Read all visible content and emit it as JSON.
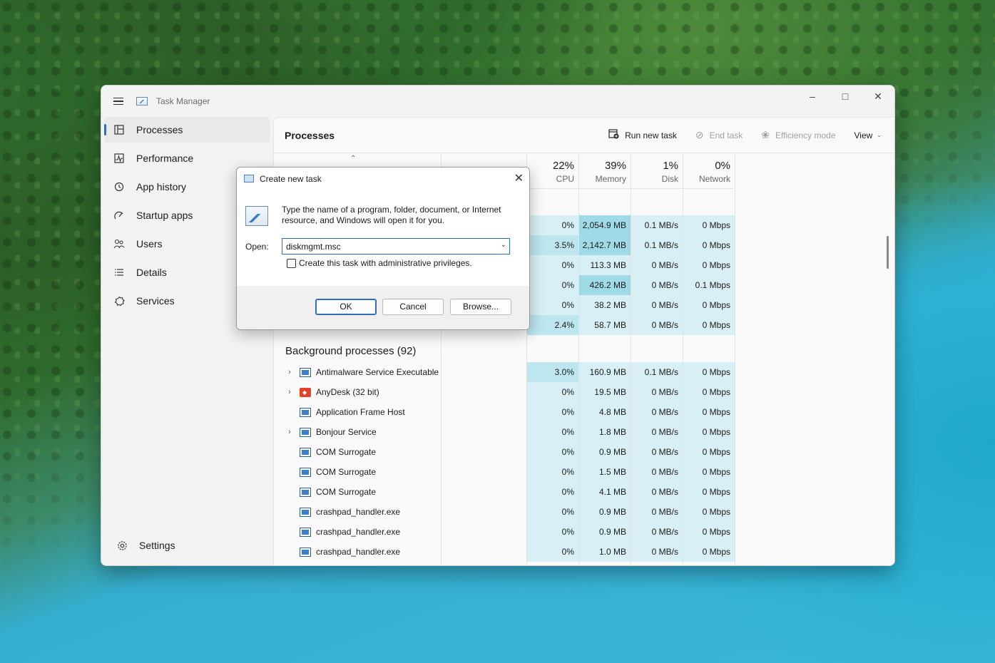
{
  "window": {
    "title": "Task Manager"
  },
  "sidebar": {
    "items": [
      {
        "label": "Processes",
        "icon": "processes-icon"
      },
      {
        "label": "Performance",
        "icon": "performance-icon"
      },
      {
        "label": "App history",
        "icon": "history-icon"
      },
      {
        "label": "Startup apps",
        "icon": "startup-icon"
      },
      {
        "label": "Users",
        "icon": "users-icon"
      },
      {
        "label": "Details",
        "icon": "details-icon"
      },
      {
        "label": "Services",
        "icon": "services-icon"
      }
    ],
    "settings_label": "Settings"
  },
  "toolbar": {
    "page_title": "Processes",
    "run_new_task": "Run new task",
    "end_task": "End task",
    "efficiency_mode": "Efficiency mode",
    "view": "View"
  },
  "columns": {
    "cpu": {
      "pct": "22%",
      "label": "CPU"
    },
    "memory": {
      "pct": "39%",
      "label": "Memory"
    },
    "disk": {
      "pct": "1%",
      "label": "Disk"
    },
    "network": {
      "pct": "0%",
      "label": "Network"
    }
  },
  "app_rows": [
    {
      "cpu": "0%",
      "memory": "2,054.9 MB",
      "disk": "0.1 MB/s",
      "network": "0 Mbps"
    },
    {
      "cpu": "3.5%",
      "memory": "2,142.7 MB",
      "disk": "0.1 MB/s",
      "network": "0 Mbps"
    },
    {
      "cpu": "0%",
      "memory": "113.3 MB",
      "disk": "0 MB/s",
      "network": "0 Mbps"
    },
    {
      "cpu": "0%",
      "memory": "426.2 MB",
      "disk": "0 MB/s",
      "network": "0.1 Mbps"
    },
    {
      "cpu": "0%",
      "memory": "38.2 MB",
      "disk": "0 MB/s",
      "network": "0 Mbps"
    },
    {
      "cpu": "2.4%",
      "memory": "58.7 MB",
      "disk": "0 MB/s",
      "network": "0 Mbps"
    }
  ],
  "background_section": {
    "title": "Background processes (92)"
  },
  "background_rows": [
    {
      "name": "Antimalware Service Executable",
      "expandable": true,
      "icon": "service-icon",
      "cpu": "3.0%",
      "memory": "160.9 MB",
      "disk": "0.1 MB/s",
      "network": "0 Mbps"
    },
    {
      "name": "AnyDesk (32 bit)",
      "expandable": true,
      "icon": "anydesk-icon",
      "cpu": "0%",
      "memory": "19.5 MB",
      "disk": "0 MB/s",
      "network": "0 Mbps"
    },
    {
      "name": "Application Frame Host",
      "expandable": false,
      "icon": "service-icon",
      "cpu": "0%",
      "memory": "4.8 MB",
      "disk": "0 MB/s",
      "network": "0 Mbps"
    },
    {
      "name": "Bonjour Service",
      "expandable": true,
      "icon": "service-icon",
      "cpu": "0%",
      "memory": "1.8 MB",
      "disk": "0 MB/s",
      "network": "0 Mbps"
    },
    {
      "name": "COM Surrogate",
      "expandable": false,
      "icon": "service-icon",
      "cpu": "0%",
      "memory": "0.9 MB",
      "disk": "0 MB/s",
      "network": "0 Mbps"
    },
    {
      "name": "COM Surrogate",
      "expandable": false,
      "icon": "service-icon",
      "cpu": "0%",
      "memory": "1.5 MB",
      "disk": "0 MB/s",
      "network": "0 Mbps"
    },
    {
      "name": "COM Surrogate",
      "expandable": false,
      "icon": "service-icon",
      "cpu": "0%",
      "memory": "4.1 MB",
      "disk": "0 MB/s",
      "network": "0 Mbps"
    },
    {
      "name": "crashpad_handler.exe",
      "expandable": false,
      "icon": "service-icon",
      "cpu": "0%",
      "memory": "0.9 MB",
      "disk": "0 MB/s",
      "network": "0 Mbps"
    },
    {
      "name": "crashpad_handler.exe",
      "expandable": false,
      "icon": "service-icon",
      "cpu": "0%",
      "memory": "0.9 MB",
      "disk": "0 MB/s",
      "network": "0 Mbps"
    },
    {
      "name": "crashpad_handler.exe",
      "expandable": false,
      "icon": "service-icon",
      "cpu": "0%",
      "memory": "1.0 MB",
      "disk": "0 MB/s",
      "network": "0 Mbps"
    }
  ],
  "dialog": {
    "title": "Create new task",
    "description": "Type the name of a program, folder, document, or Internet resource, and Windows will open it for you.",
    "open_label": "Open:",
    "open_value": "diskmgmt.msc",
    "admin_checkbox_label": "Create this task with administrative privileges.",
    "admin_checked": false,
    "ok": "OK",
    "cancel": "Cancel",
    "browse": "Browse..."
  },
  "colors": {
    "accent": "#3a6db5",
    "heat_low": "#d8f0f5",
    "heat_mid": "#bde6ee",
    "heat_high": "#9fdbe7"
  }
}
